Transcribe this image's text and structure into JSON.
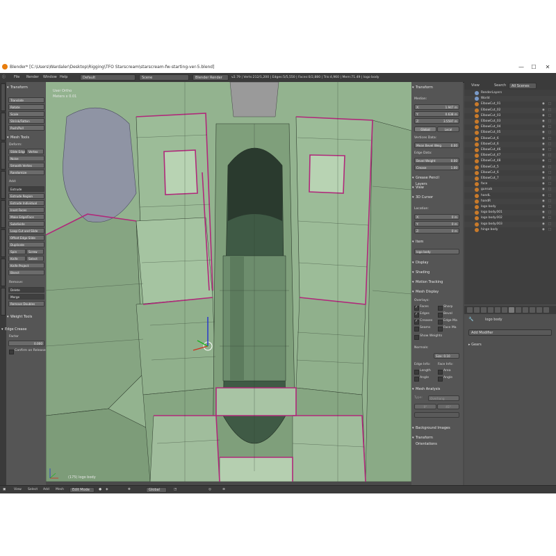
{
  "window": {
    "title": "Blender* [C:\\Users\\Wardaler\\Desktop\\Rigging\\TFO Starscream\\starscream-fw-starting-ver-5.blend]",
    "minimize": "—",
    "maximize": "☐",
    "close": "✕"
  },
  "menu": {
    "items": [
      "File",
      "Render",
      "Window",
      "Help"
    ],
    "layout": "Default",
    "scene": "Scene",
    "engine": "Blender Render",
    "stats": "v2.79 | Verts:212/1,200 | Edges:5/5,550 | Faces:0/2,880 | Tris:4,960 | Mem:71.49 | logo body"
  },
  "toolshelf": {
    "transform_header": "Transform",
    "transform_buttons": [
      "Translate",
      "Rotate",
      "Scale",
      "Shrink/Fatten",
      "Push/Pull"
    ],
    "mesh_tools_header": "Mesh Tools",
    "deform_label": "Deform:",
    "slide_edge": "Slide Edge",
    "vertex": "Vertex",
    "noise": "Noise",
    "smooth_vertex": "Smooth Vertex",
    "randomize": "Randomize",
    "add_label": "Add:",
    "extrude": "Extrude",
    "add_buttons": [
      "Extrude Region",
      "Extrude Individual",
      "Inset Faces",
      "Make Edge/Face",
      "Subdivide",
      "Loop Cut and Slide",
      "Offset Edge Slide",
      "Duplicate"
    ],
    "spin": "Spin",
    "screw": "Screw",
    "knife": "Knife",
    "select": "Select",
    "knife_project": "Knife Project",
    "bisect": "Bisect",
    "remove_label": "Remove:",
    "delete": "Delete",
    "merge": "Merge",
    "remove_doubles": "Remove Doubles",
    "weight_tools_header": "Weight Tools",
    "edge_crease_header": "Edge Crease",
    "factor_label": "Factor",
    "factor_value": "0.000",
    "confirm_release": "Confirm on Release"
  },
  "viewport": {
    "view_label": "User Ortho",
    "meters": "Meters x 0.01",
    "object_label": "(175) logo body"
  },
  "nprops": {
    "transform_header": "Transform",
    "median_label": "Median:",
    "x_label": "X:",
    "x_value": "1.947 m",
    "y_label": "Y:",
    "y_value": "0.638 m",
    "z_label": "Z:",
    "z_value": "3.5597 m",
    "global": "Global",
    "local": "Local",
    "vertices_data": "Vertices Data:",
    "mean_bevel_weight": "Mean Bevel Weig",
    "mean_bevel_weight_value": "0.00",
    "edge_data": "Edge Data:",
    "bevel_weight": "Bevel Weight",
    "bevel_weight_value": "0.00",
    "crease": "Crease",
    "crease_value": "1.00",
    "grease_pencil": "Grease Pencil Layers",
    "view_header": "View",
    "cursor_header": "3D Cursor",
    "location_label": "Location:",
    "cx_label": "X:",
    "cx_value": "0 m",
    "cy_label": "Y:",
    "cy_value": "0 m",
    "cz_label": "Z:",
    "cz_value": "0 m",
    "item_header": "Item",
    "item_name": "logo body",
    "display_header": "Display",
    "shading_header": "Shading",
    "motion_tracking": "Motion Tracking",
    "mesh_display": "Mesh Display",
    "overlays_label": "Overlays:",
    "faces": "Faces",
    "sharp": "Sharp",
    "edges": "Edges",
    "bevel": "Bevel",
    "creases": "Creases",
    "edge_marks": "Edge Ma",
    "seams": "Seams",
    "face_marks": "Face Ma",
    "show_weights": "Show Weights",
    "normals_label": "Normals:",
    "normals_size": "Size: 0.10",
    "edge_info": "Edge Info:",
    "face_info": "Face Info:",
    "length": "Length",
    "area": "Area",
    "angle": "Angle",
    "angle2": "Angle",
    "mesh_analysis": "Mesh Analysis",
    "type_label": "Type:",
    "type_value": "Overhang",
    "ang_min": "0°",
    "ang_max": "45°",
    "background_images": "Background Images",
    "transform_orientations": "Transform Orientations"
  },
  "outliner": {
    "view": "View",
    "search": "Search",
    "filter": "All Scenes",
    "items": [
      "RenderLayers",
      "World",
      "ElbowCut_01",
      "ElbowCut_02",
      "ElbowCut_03",
      "ElbowCut_03",
      "ElbowCut_04",
      "ElbowCut_05",
      "ElbowCut_6",
      "ElbowCut_6",
      "ElbowCut_46",
      "ElbowCut_47",
      "ElbowCut_48",
      "ElbowCut_5",
      "ElbowCut_6",
      "ElbowCut_7",
      "face",
      "gunsub",
      "handL",
      "handR",
      "logo body",
      "logo body.001",
      "logo body.002",
      "logo body.003",
      "hinge body"
    ]
  },
  "properties": {
    "object_name": "logo body",
    "add_modifier": "Add Modifier",
    "gears": "Gears"
  },
  "bottom": {
    "items": [
      "View",
      "Select",
      "Add",
      "Mesh"
    ],
    "mode": "Edit Mode",
    "orientation": "Global"
  },
  "colors": {
    "mesh_face": "#8fb08a",
    "edge_highlight": "#b0287a",
    "panel": "#555555",
    "header": "#3b3b3b"
  }
}
